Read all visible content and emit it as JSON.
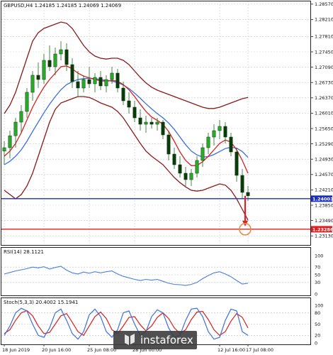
{
  "chart_data": {
    "type": "line",
    "main": {
      "title": "GBPUSD,H4  1.24185 1.24185 1.24069 1.24069",
      "ylim": [
        1.2295,
        1.286
      ],
      "y_ticks": [
        1.2857,
        1.2821,
        1.2781,
        1.2745,
        1.2709,
        1.2673,
        1.2637,
        1.2601,
        1.2565,
        1.2529,
        1.2493,
        1.2457,
        1.2421,
        1.2385,
        1.2349,
        1.2313
      ],
      "y_tick_labels": [
        "1.28570",
        "1.28210",
        "1.27810",
        "1.27450",
        "1.27090",
        "1.26730",
        "1.26370",
        "1.26010",
        "1.25650",
        "1.25290",
        "1.24930",
        "1.24570",
        "1.24210",
        "1.23850",
        "1.23490",
        "1.23130"
      ],
      "current_price": 1.24003,
      "current_price_label": "1.24003",
      "current_price_color": "#1a2fbf",
      "target_price": 1.23286,
      "target_price_label": "1.23286",
      "target_color": "#e02020",
      "candles": [
        {
          "o": 1.2512,
          "h": 1.2535,
          "l": 1.248,
          "c": 1.252
        },
        {
          "o": 1.252,
          "h": 1.256,
          "l": 1.2495,
          "c": 1.2548
        },
        {
          "o": 1.2548,
          "h": 1.259,
          "l": 1.252,
          "c": 1.258
        },
        {
          "o": 1.258,
          "h": 1.262,
          "l": 1.2555,
          "c": 1.2605
        },
        {
          "o": 1.2605,
          "h": 1.266,
          "l": 1.259,
          "c": 1.265
        },
        {
          "o": 1.265,
          "h": 1.27,
          "l": 1.263,
          "c": 1.269
        },
        {
          "o": 1.269,
          "h": 1.272,
          "l": 1.266,
          "c": 1.268
        },
        {
          "o": 1.268,
          "h": 1.274,
          "l": 1.267,
          "c": 1.2725
        },
        {
          "o": 1.2725,
          "h": 1.276,
          "l": 1.27,
          "c": 1.271
        },
        {
          "o": 1.271,
          "h": 1.2755,
          "l": 1.269,
          "c": 1.274
        },
        {
          "o": 1.274,
          "h": 1.277,
          "l": 1.2725,
          "c": 1.275
        },
        {
          "o": 1.275,
          "h": 1.2765,
          "l": 1.27,
          "c": 1.2715
        },
        {
          "o": 1.2715,
          "h": 1.273,
          "l": 1.266,
          "c": 1.2675
        },
        {
          "o": 1.2675,
          "h": 1.27,
          "l": 1.264,
          "c": 1.266
        },
        {
          "o": 1.266,
          "h": 1.269,
          "l": 1.265,
          "c": 1.268
        },
        {
          "o": 1.268,
          "h": 1.271,
          "l": 1.266,
          "c": 1.267
        },
        {
          "o": 1.267,
          "h": 1.2695,
          "l": 1.265,
          "c": 1.2685
        },
        {
          "o": 1.2685,
          "h": 1.27,
          "l": 1.2655,
          "c": 1.2665
        },
        {
          "o": 1.2665,
          "h": 1.269,
          "l": 1.265,
          "c": 1.268
        },
        {
          "o": 1.268,
          "h": 1.271,
          "l": 1.267,
          "c": 1.2695
        },
        {
          "o": 1.2695,
          "h": 1.2705,
          "l": 1.265,
          "c": 1.266
        },
        {
          "o": 1.266,
          "h": 1.2675,
          "l": 1.262,
          "c": 1.263
        },
        {
          "o": 1.263,
          "h": 1.265,
          "l": 1.26,
          "c": 1.2615
        },
        {
          "o": 1.2615,
          "h": 1.263,
          "l": 1.258,
          "c": 1.259
        },
        {
          "o": 1.259,
          "h": 1.261,
          "l": 1.256,
          "c": 1.2575
        },
        {
          "o": 1.2575,
          "h": 1.2595,
          "l": 1.2555,
          "c": 1.258
        },
        {
          "o": 1.258,
          "h": 1.259,
          "l": 1.2565,
          "c": 1.2575
        },
        {
          "o": 1.2575,
          "h": 1.259,
          "l": 1.256,
          "c": 1.258
        },
        {
          "o": 1.258,
          "h": 1.2585,
          "l": 1.254,
          "c": 1.255
        },
        {
          "o": 1.255,
          "h": 1.256,
          "l": 1.249,
          "c": 1.2505
        },
        {
          "o": 1.2505,
          "h": 1.252,
          "l": 1.247,
          "c": 1.248
        },
        {
          "o": 1.248,
          "h": 1.25,
          "l": 1.245,
          "c": 1.246
        },
        {
          "o": 1.246,
          "h": 1.2475,
          "l": 1.243,
          "c": 1.2445
        },
        {
          "o": 1.2445,
          "h": 1.247,
          "l": 1.243,
          "c": 1.246
        },
        {
          "o": 1.246,
          "h": 1.25,
          "l": 1.245,
          "c": 1.249
        },
        {
          "o": 1.249,
          "h": 1.253,
          "l": 1.2475,
          "c": 1.252
        },
        {
          "o": 1.252,
          "h": 1.2555,
          "l": 1.2505,
          "c": 1.2545
        },
        {
          "o": 1.2545,
          "h": 1.2575,
          "l": 1.2525,
          "c": 1.256
        },
        {
          "o": 1.256,
          "h": 1.2585,
          "l": 1.254,
          "c": 1.257
        },
        {
          "o": 1.257,
          "h": 1.258,
          "l": 1.253,
          "c": 1.2545
        },
        {
          "o": 1.2545,
          "h": 1.2555,
          "l": 1.25,
          "c": 1.251
        },
        {
          "o": 1.251,
          "h": 1.252,
          "l": 1.244,
          "c": 1.2455
        },
        {
          "o": 1.2455,
          "h": 1.247,
          "l": 1.24,
          "c": 1.2415
        },
        {
          "o": 1.2415,
          "h": 1.243,
          "l": 1.2395,
          "c": 1.2407
        }
      ],
      "sma_fast": [
        1.25,
        1.2512,
        1.253,
        1.2555,
        1.2585,
        1.2615,
        1.264,
        1.2662,
        1.268,
        1.2695,
        1.271,
        1.2712,
        1.2705,
        1.2695,
        1.2688,
        1.2684,
        1.268,
        1.2677,
        1.2676,
        1.2678,
        1.2676,
        1.2668,
        1.2656,
        1.264,
        1.2622,
        1.2605,
        1.2592,
        1.2584,
        1.2575,
        1.2558,
        1.2535,
        1.251,
        1.249,
        1.2478,
        1.2478,
        1.2487,
        1.25,
        1.2515,
        1.253,
        1.2538,
        1.2533,
        1.2515,
        1.249,
        1.246
      ],
      "sma_slow": [
        1.248,
        1.2488,
        1.25,
        1.2515,
        1.2535,
        1.2558,
        1.258,
        1.2602,
        1.2622,
        1.264,
        1.2656,
        1.2668,
        1.2675,
        1.268,
        1.2682,
        1.2683,
        1.2682,
        1.268,
        1.2678,
        1.2676,
        1.2673,
        1.2667,
        1.2659,
        1.2648,
        1.2636,
        1.2623,
        1.2611,
        1.26,
        1.259,
        1.2578,
        1.2563,
        1.2545,
        1.2527,
        1.2512,
        1.2503,
        1.2498,
        1.2499,
        1.2504,
        1.2511,
        1.2518,
        1.2521,
        1.2519,
        1.2511,
        1.2497
      ],
      "bb_upper": [
        1.26,
        1.262,
        1.265,
        1.269,
        1.273,
        1.277,
        1.279,
        1.28,
        1.2805,
        1.281,
        1.2815,
        1.2812,
        1.28,
        1.278,
        1.276,
        1.2745,
        1.2735,
        1.273,
        1.2728,
        1.273,
        1.273,
        1.2725,
        1.2715,
        1.27,
        1.2685,
        1.2672,
        1.2662,
        1.2655,
        1.265,
        1.2645,
        1.264,
        1.2635,
        1.263,
        1.2625,
        1.262,
        1.2615,
        1.2612,
        1.2612,
        1.2615,
        1.262,
        1.2625,
        1.263,
        1.2635,
        1.2638
      ],
      "bb_lower": [
        1.242,
        1.241,
        1.24,
        1.241,
        1.243,
        1.246,
        1.25,
        1.254,
        1.258,
        1.261,
        1.2625,
        1.263,
        1.2635,
        1.264,
        1.264,
        1.2638,
        1.2632,
        1.2625,
        1.262,
        1.2615,
        1.2605,
        1.259,
        1.257,
        1.255,
        1.253,
        1.2512,
        1.25,
        1.249,
        1.248,
        1.2465,
        1.245,
        1.2438,
        1.2428,
        1.242,
        1.2418,
        1.242,
        1.2425,
        1.243,
        1.2435,
        1.2432,
        1.242,
        1.24,
        1.2375,
        1.235
      ]
    },
    "rsi": {
      "title": "RSI(14) 28.1121",
      "ylim": [
        0,
        100
      ],
      "y_ticks": [
        100,
        70,
        50,
        30,
        0
      ],
      "y_tick_labels": [
        "100",
        "70",
        "50",
        "30",
        "0"
      ],
      "values": [
        52,
        56,
        60,
        63,
        66,
        70,
        68,
        71,
        65,
        69,
        72,
        62,
        55,
        52,
        57,
        54,
        58,
        55,
        58,
        60,
        52,
        46,
        42,
        38,
        35,
        38,
        36,
        38,
        33,
        28,
        25,
        24,
        22,
        25,
        30,
        40,
        48,
        55,
        58,
        52,
        45,
        35,
        26,
        28
      ]
    },
    "stoch": {
      "title": "Stoch(5,3,3) 20.4002 15.1941",
      "ylim": [
        0,
        100
      ],
      "y_ticks": [
        100,
        80,
        50,
        20,
        0
      ],
      "y_tick_labels": [
        "100",
        "80",
        "50",
        "20",
        "0"
      ],
      "main": [
        20,
        45,
        80,
        92,
        85,
        50,
        20,
        15,
        40,
        80,
        90,
        60,
        25,
        10,
        30,
        75,
        90,
        70,
        30,
        15,
        35,
        80,
        85,
        50,
        20,
        30,
        70,
        88,
        80,
        40,
        15,
        20,
        60,
        90,
        92,
        70,
        30,
        10,
        15,
        60,
        90,
        85,
        30,
        20
      ],
      "signal": [
        25,
        35,
        60,
        80,
        86,
        72,
        45,
        25,
        28,
        50,
        72,
        78,
        55,
        30,
        20,
        45,
        70,
        82,
        65,
        35,
        25,
        45,
        68,
        70,
        48,
        32,
        45,
        68,
        80,
        65,
        40,
        25,
        35,
        62,
        82,
        84,
        62,
        35,
        20,
        30,
        58,
        78,
        68,
        40
      ]
    },
    "x_ticks": [
      {
        "label": "18 Jun 2019",
        "i": 0
      },
      {
        "label": "20 Jun 16:00",
        "i": 7
      },
      {
        "label": "25 Jun 08:00",
        "i": 15
      },
      {
        "label": "28 Jun 00:00",
        "i": 23
      },
      {
        "label": "12 Jul 16:00",
        "i": 38
      },
      {
        "label": "17 Jul 08:00",
        "i": 43
      }
    ]
  },
  "watermark": {
    "text": "instaforex"
  }
}
